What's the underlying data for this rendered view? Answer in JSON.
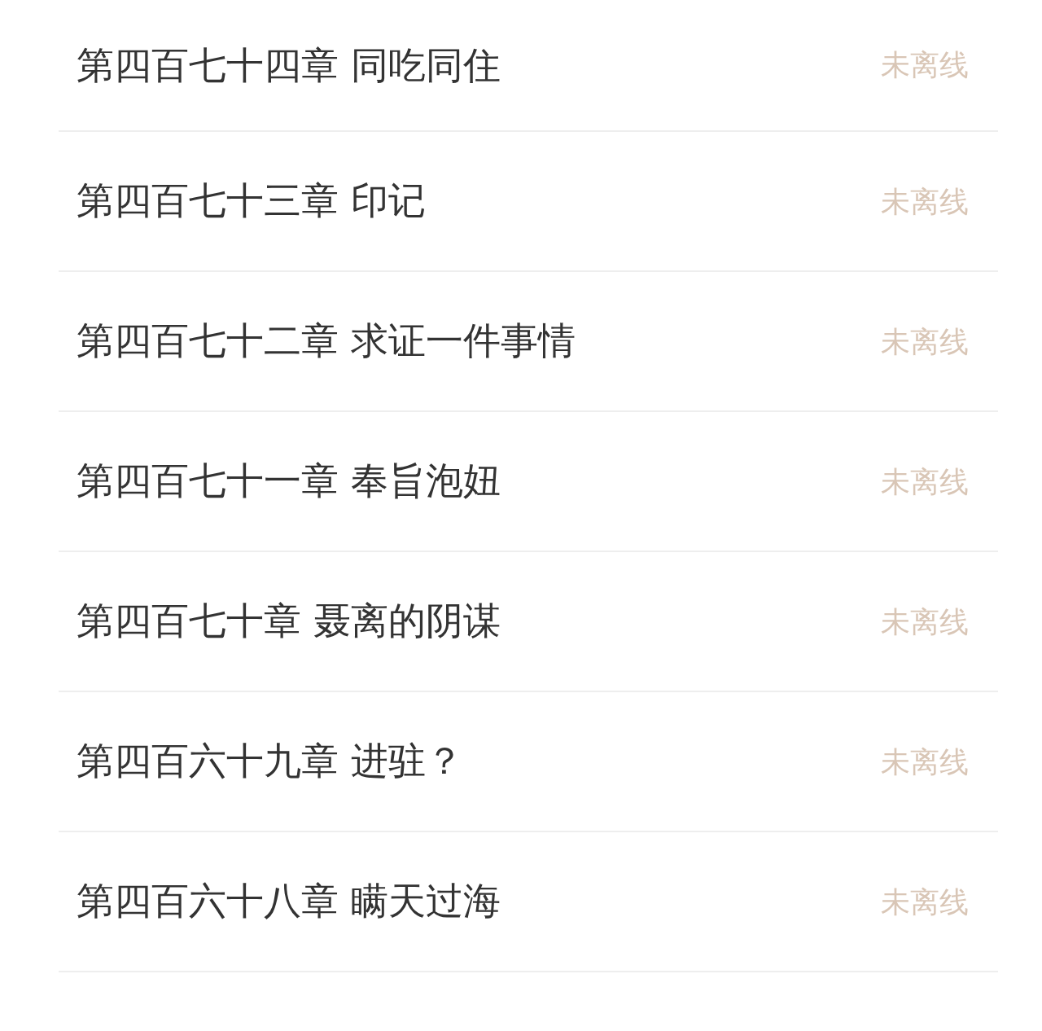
{
  "chapters": [
    {
      "title": "第四百七十四章 同吃同住",
      "status": "未离线"
    },
    {
      "title": "第四百七十三章 印记",
      "status": "未离线"
    },
    {
      "title": "第四百七十二章 求证一件事情",
      "status": "未离线"
    },
    {
      "title": "第四百七十一章 奉旨泡妞",
      "status": "未离线"
    },
    {
      "title": "第四百七十章 聂离的阴谋",
      "status": "未离线"
    },
    {
      "title": "第四百六十九章 进驻？",
      "status": "未离线"
    },
    {
      "title": "第四百六十八章 瞒天过海",
      "status": "未离线"
    }
  ]
}
